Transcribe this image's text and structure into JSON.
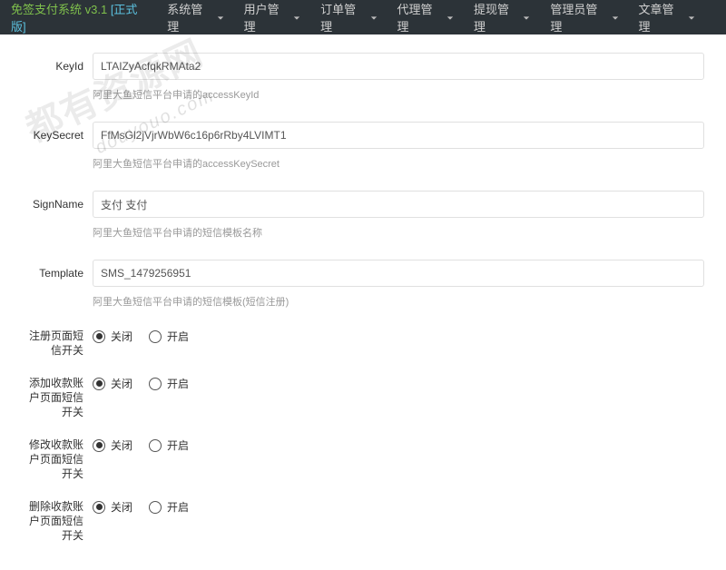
{
  "brand": {
    "name": "免签支付系统 v3.1",
    "version_tag": "[正式版]"
  },
  "nav": [
    {
      "label": "系统管理"
    },
    {
      "label": "用户管理"
    },
    {
      "label": "订单管理"
    },
    {
      "label": "代理管理"
    },
    {
      "label": "提现管理"
    },
    {
      "label": "管理员管理"
    },
    {
      "label": "文章管理"
    }
  ],
  "fields": {
    "keyid": {
      "label": "KeyId",
      "value": "LTAIZyAcfqkRMAta2",
      "hint": "阿里大鱼短信平台申请的accessKeyId"
    },
    "keysecret": {
      "label": "KeySecret",
      "value": "FfMsGl2jVjrWbW6c16p6rRby4LVIMT1",
      "hint": "阿里大鱼短信平台申请的accessKeySecret"
    },
    "signname": {
      "label": "SignName",
      "value": "支付 支付",
      "hint": "阿里大鱼短信平台申请的短信模板名称"
    },
    "template": {
      "label": "Template",
      "value": "SMS_1479256951",
      "hint": "阿里大鱼短信平台申请的短信模板(短信注册)"
    }
  },
  "radio_options": {
    "off": "关闭",
    "on": "开启"
  },
  "switches": [
    {
      "label": "注册页面短信开关",
      "selected": "off"
    },
    {
      "label": "添加收款账户页面短信开关",
      "selected": "off"
    },
    {
      "label": "修改收款账户页面短信开关",
      "selected": "off"
    },
    {
      "label": "删除收款账户页面短信开关",
      "selected": "off"
    }
  ],
  "watermark": {
    "big": "都有资源网",
    "url": "douyouo.com"
  }
}
